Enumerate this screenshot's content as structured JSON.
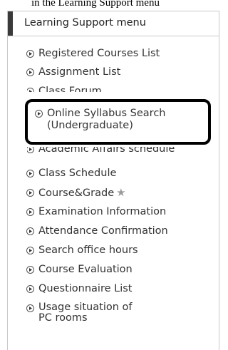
{
  "caption": "in the Learning Support menu",
  "panel": {
    "title": "Learning Support menu"
  },
  "menu": {
    "registered_courses": "Registered Courses List",
    "assignment_list": "Assignment List",
    "class_forum": "Class Forum",
    "syllabus_line1": "Online Syllabus Search",
    "syllabus_line2": "(Undergraduate)",
    "academic_affairs": "Academic Affairs schedule",
    "class_schedule": "Class Schedule",
    "course_grade": "Course&Grade",
    "examination_info": "Examination Information",
    "attendance": "Attendance Confirmation",
    "office_hours": "Search office hours",
    "course_evaluation": "Course Evaluation",
    "questionnaire": "Questionnaire List",
    "pc_rooms_line1": "Usage situation of",
    "pc_rooms_line2": "PC rooms"
  },
  "icons": {
    "bullet": "circle-arrow-icon",
    "star": "star-icon"
  },
  "colors": {
    "header_accent": "#3a3a3a",
    "highlight_border": "#000000",
    "star": "#9a9a9a"
  }
}
